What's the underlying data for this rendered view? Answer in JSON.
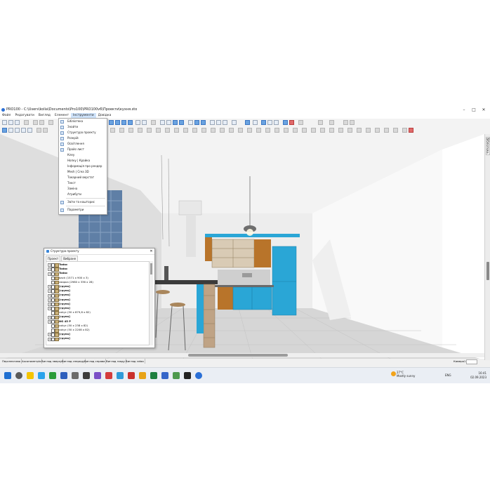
{
  "window": {
    "title": "PRO100 - C:\\Users\\kolia\\Documents\\Pro100\\PRO100v6\\Проекти\\кухня.sto",
    "minimize": "–",
    "maximize": "□",
    "close": "✕"
  },
  "menu": {
    "items": [
      "Файл",
      "Редагувати",
      "Вигляд",
      "Елемент",
      "Інструменти",
      "Довідка"
    ]
  },
  "dropdown": {
    "items": [
      {
        "label": "Бібліотека",
        "icon": "library-icon"
      },
      {
        "label": "Знайти",
        "icon": "find-icon"
      },
      {
        "label": "Структура проекту",
        "icon": "structure-icon"
      },
      {
        "label": "Розкрій",
        "icon": "cutting-icon"
      },
      {
        "label": "Освітлення",
        "icon": "lighting-icon"
      },
      {
        "label": "Прайс-лист",
        "icon": "pricelist-icon"
      },
      {
        "label": "Клеу",
        "icon": ""
      },
      {
        "label": "Нопку | Крайка",
        "icon": ""
      },
      {
        "label": "Інформація про рендер",
        "icon": ""
      },
      {
        "label": "Mesh | Crea 3D",
        "icon": ""
      },
      {
        "label": "Токарний верстат",
        "icon": ""
      },
      {
        "label": "Текст",
        "icon": ""
      },
      {
        "label": "Заміна",
        "icon": ""
      },
      {
        "label": "Атрибути",
        "icon": ""
      },
      {
        "label": "Звіти та кошторис",
        "icon": "report-icon"
      },
      {
        "label": "Параметри",
        "icon": "settings-icon"
      }
    ]
  },
  "panel": {
    "title": "Структура проекту",
    "close": "✕",
    "tabs": [
      "Проект",
      "Вибране"
    ],
    "rows": [
      {
        "text": "Todac",
        "bold": true,
        "expand": "+"
      },
      {
        "text": "Todac",
        "bold": true,
        "expand": "+"
      },
      {
        "text": "Todac",
        "bold": true,
        "expand": "+"
      },
      {
        "text": "back  (1571 x 900 x 3)",
        "bold": false,
        "expand": ""
      },
      {
        "text": "сварка  (2980 x 336 x 28)",
        "bold": false,
        "expand": ""
      },
      {
        "text": "[група]",
        "bold": true,
        "expand": "+"
      },
      {
        "text": "[група]",
        "bold": true,
        "expand": "+"
      },
      {
        "text": "[група]",
        "bold": true,
        "expand": "+"
      },
      {
        "text": "[група]",
        "bold": true,
        "expand": "+"
      },
      {
        "text": "[група]",
        "bold": true,
        "expand": "+"
      },
      {
        "text": "[група]",
        "bold": true,
        "expand": "+"
      },
      {
        "text": "cokyc  (50 x 879,8 x 82)",
        "bold": false,
        "expand": ""
      },
      {
        "text": "[група]",
        "bold": true,
        "expand": "+"
      },
      {
        "text": "NG 45 P",
        "bold": true,
        "expand": "+"
      },
      {
        "text": "cokyc  (50 x 238 x 82)",
        "bold": false,
        "expand": ""
      },
      {
        "text": "cokyc  (50 x 2208 x 82)",
        "bold": false,
        "expand": ""
      },
      {
        "text": "[група]",
        "bold": true,
        "expand": "+"
      },
      {
        "text": "[група]",
        "bold": true,
        "expand": "+"
      }
    ]
  },
  "side_tab": "Бібліотека",
  "view_tabs": [
    "Перспектива",
    "Аксонометрія",
    "Вигляд зверху",
    "Вигляд спереду",
    "Вигляд справа",
    "Вигляд ззаду",
    "Вигляд зліва"
  ],
  "camera_label": "Камера1",
  "taskbar": {
    "weather_temp": "27°C",
    "weather_desc": "Mostly sunny",
    "lang": "ENG",
    "time": "16:41",
    "date": "02.09.2023",
    "weather_badge": "1"
  },
  "colors": {
    "accent_blue": "#2aa6d6",
    "wood": "#b8742a",
    "floor": "#d9d9d9"
  }
}
